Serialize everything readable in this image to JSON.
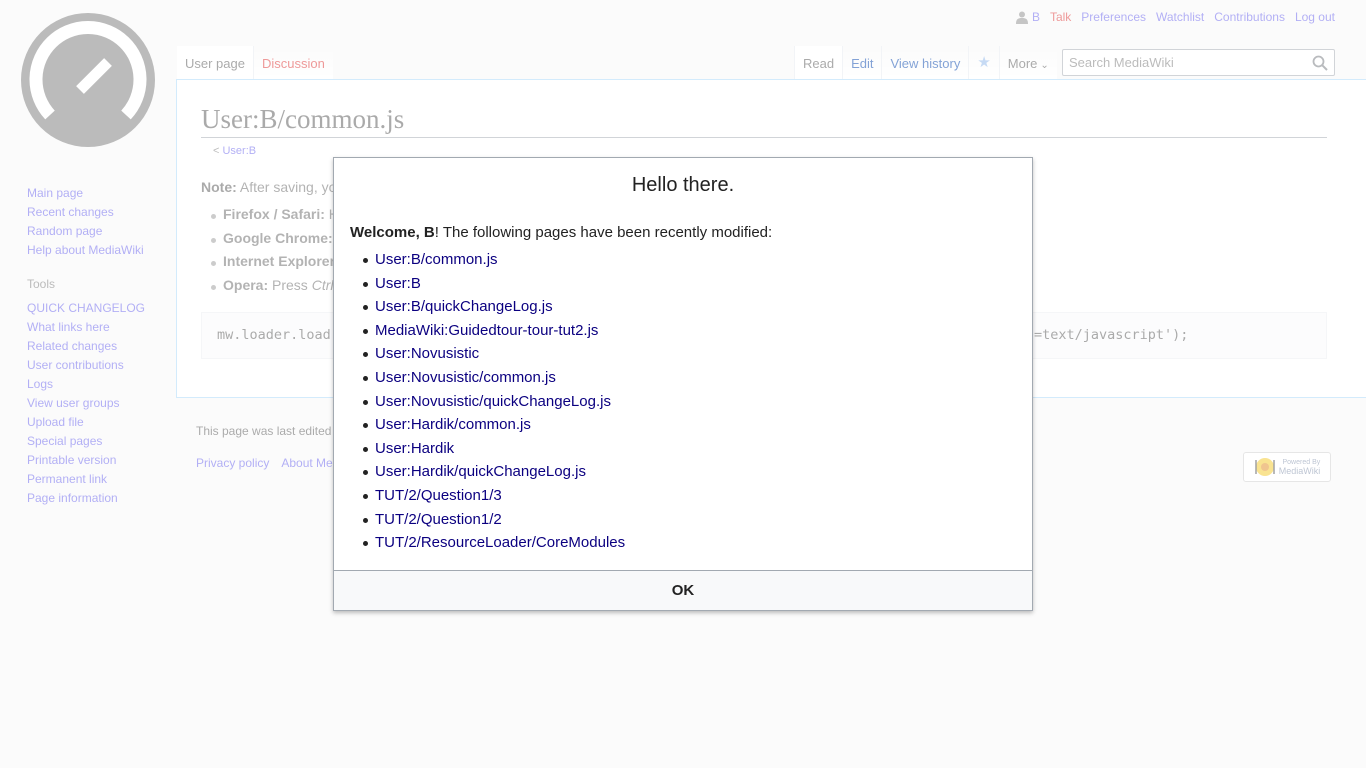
{
  "personal_tools": {
    "user": "B",
    "talk": "Talk",
    "preferences": "Preferences",
    "watchlist": "Watchlist",
    "contributions": "Contributions",
    "logout": "Log out"
  },
  "namespace_tabs": [
    "User page",
    "Discussion"
  ],
  "view_tabs": {
    "read": "Read",
    "edit": "Edit",
    "history": "View history",
    "more": "More"
  },
  "search": {
    "placeholder": "Search MediaWiki"
  },
  "content": {
    "title": "User:B/common.js",
    "subpages_prefix": "< ",
    "subpages_link": "User:B",
    "note_label": "Note:",
    "note_text": " After saving, yo",
    "browsers": [
      {
        "name": "Firefox / Safari:",
        "rest": " H"
      },
      {
        "name": "Google Chrome:",
        "rest": ""
      },
      {
        "name": "Internet Explorer",
        "rest": ""
      },
      {
        "name": "Opera:",
        "rest": " Press ",
        "em": "Ctrl"
      }
    ],
    "code_left": "mw.loader.load",
    "code_right": "=text/javascript');"
  },
  "sidebar": {
    "main": [
      "Main page",
      "Recent changes",
      "Random page",
      "Help about MediaWiki"
    ],
    "tools_heading": "Tools",
    "tools": [
      "QUICK CHANGELOG",
      "What links here",
      "Related changes",
      "User contributions",
      "Logs",
      "View user groups",
      "Upload file",
      "Special pages",
      "Printable version",
      "Permanent link",
      "Page information"
    ]
  },
  "footer": {
    "lastmod": "This page was last edited",
    "links": [
      "Privacy policy",
      "About Me"
    ],
    "powered_line1": "Powered By",
    "powered_line2": "MediaWiki"
  },
  "dialog": {
    "title": "Hello there.",
    "welcome_bold": "Welcome, B",
    "welcome_rest": "! The following pages have been recently modified:",
    "pages": [
      "User:B/common.js",
      "User:B",
      "User:B/quickChangeLog.js",
      "MediaWiki:Guidedtour-tour-tut2.js",
      "User:Novusistic",
      "User:Novusistic/common.js",
      "User:Novusistic/quickChangeLog.js",
      "User:Hardik/common.js",
      "User:Hardik",
      "User:Hardik/quickChangeLog.js",
      "TUT/2/Question1/3",
      "TUT/2/Question1/2",
      "TUT/2/ResourceLoader/CoreModules"
    ],
    "ok": "OK"
  },
  "colors": {
    "link": "#645eea",
    "new_link": "#d33",
    "dialog_link": "#0b0080",
    "logo_gray": "#777777"
  }
}
